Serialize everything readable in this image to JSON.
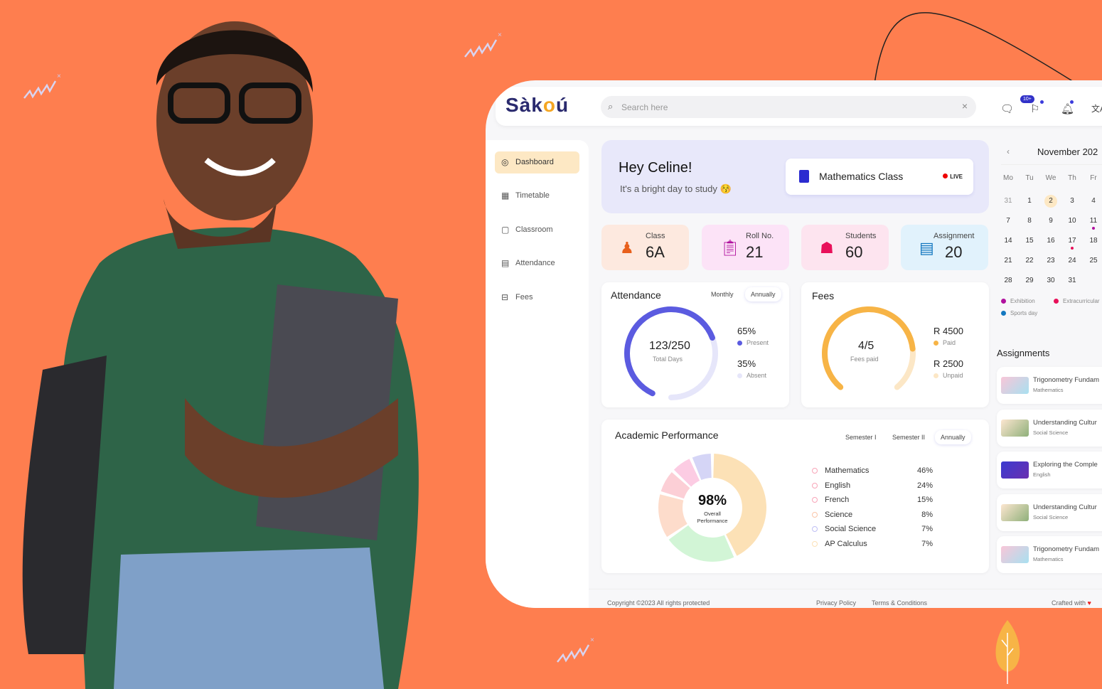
{
  "brand": {
    "logo": "Sàkoú",
    "bg_color": "#FE7E4F"
  },
  "header": {
    "search_placeholder": "Search here",
    "messages_badge": "10+",
    "icons": [
      "message-icon",
      "announcement-icon",
      "bell-icon",
      "translate-icon"
    ]
  },
  "sidebar": {
    "items": [
      {
        "label": "Dashboard",
        "icon": "dashboard-icon",
        "active": true
      },
      {
        "label": "Timetable",
        "icon": "timetable-icon"
      },
      {
        "label": "Classroom",
        "icon": "classroom-icon"
      },
      {
        "label": "Attendance",
        "icon": "attendance-icon"
      },
      {
        "label": "Fees",
        "icon": "fees-icon"
      }
    ]
  },
  "banner": {
    "greeting": "Hey Celine!",
    "subtitle": "It's a bright day to study 😚",
    "live_class": "Mathematics Class",
    "live_label": "LIVE"
  },
  "stats": [
    {
      "label": "Class",
      "value": "6A",
      "icon": "classroom-icon",
      "bg": "#FDE9DF"
    },
    {
      "label": "Roll No.",
      "value": "21",
      "icon": "clipboard-icon",
      "bg": "#FCE3F7"
    },
    {
      "label": "Students",
      "value": "60",
      "icon": "student-icon",
      "bg": "#FDE4EF"
    },
    {
      "label": "Assignment",
      "value": "20",
      "icon": "assignment-icon",
      "bg": "#E1F2FC"
    }
  ],
  "attendance": {
    "title": "Attendance",
    "tabs": [
      "Monthly",
      "Annually"
    ],
    "active_tab": "Annually",
    "value": "123/250",
    "caption": "Total Days",
    "present_pct": "65%",
    "present_label": "Present",
    "absent_pct": "35%",
    "absent_label": "Absent",
    "fraction": 0.65,
    "color": "#5B5BE0",
    "track": "#E6E6FA"
  },
  "fees": {
    "title": "Fees",
    "value": "4/5",
    "caption": "Fees paid",
    "paid": "R 4500",
    "paid_label": "Paid",
    "unpaid": "R 2500",
    "unpaid_label": "Unpaid",
    "fraction": 0.8,
    "color": "#F7B446",
    "track": "#FCE7C6"
  },
  "performance": {
    "title": "Academic Performance",
    "tabs": [
      "Semester I",
      "Semester II",
      "Annually"
    ],
    "active_tab": "Annually",
    "overall": "98%",
    "overall_label": "Overall Performance",
    "subjects": [
      {
        "name": "Mathematics",
        "pct": "46%",
        "color": "#FCE1B6",
        "ring": "#F8A5B8"
      },
      {
        "name": "English",
        "pct": "24%",
        "color": "#D2F5D6",
        "ring": "#F8A5B8"
      },
      {
        "name": "French",
        "pct": "15%",
        "color": "#FDDCCB",
        "ring": "#F8A5B8"
      },
      {
        "name": "Science",
        "pct": "8%",
        "color": "#FCCFD6",
        "ring": "#FBC5A8"
      },
      {
        "name": "Social Science",
        "pct": "7%",
        "color": "#FCCCE3",
        "ring": "#BFBFF5"
      },
      {
        "name": "AP Calculus",
        "pct": "7%",
        "color": "#D5D5F6",
        "ring": "#FCE1B6"
      }
    ]
  },
  "calendar": {
    "month": "November 202",
    "weekdays": [
      "Mo",
      "Tu",
      "We",
      "Th",
      "Fr"
    ],
    "weeks": [
      [
        "31",
        "1",
        "2",
        "3",
        "4"
      ],
      [
        "7",
        "8",
        "9",
        "10",
        "11"
      ],
      [
        "14",
        "15",
        "16",
        "17",
        "18"
      ],
      [
        "21",
        "22",
        "23",
        "24",
        "25"
      ],
      [
        "28",
        "29",
        "30",
        "31",
        ""
      ]
    ],
    "today": "2",
    "legend": [
      {
        "label": "Exhibition",
        "color": "#B0119E"
      },
      {
        "label": "Extracurricular",
        "color": "#E8105A"
      },
      {
        "label": "Sports day",
        "color": "#1478C0"
      }
    ]
  },
  "assignments": {
    "title": "Assignments",
    "items": [
      {
        "title": "Trigonometry Fundam",
        "subject": "Mathematics"
      },
      {
        "title": "Understanding Cultur",
        "subject": "Social Science"
      },
      {
        "title": "Exploring the Comple",
        "subject": "English"
      },
      {
        "title": "Understanding Cultur",
        "subject": "Social Science"
      },
      {
        "title": "Trigonometry Fundam",
        "subject": "Mathematics"
      }
    ]
  },
  "footer": {
    "copyright": "Copyright ©2023 All rights protected",
    "privacy": "Privacy Policy",
    "terms": "Terms & Conditions",
    "crafted": "Crafted with"
  }
}
